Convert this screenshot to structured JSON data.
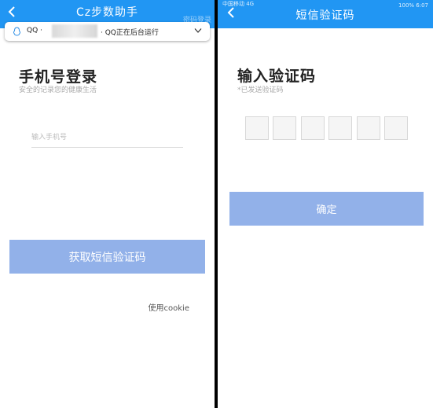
{
  "left": {
    "appbar": {
      "title": "Cz步数助手",
      "right_action": "密码登录"
    },
    "notification": {
      "app": "QQ ·",
      "message": "· QQ正在后台运行"
    },
    "title": "手机号登录",
    "subtitle": "安全的记录您的健康生活",
    "phone_placeholder": "输入手机号",
    "get_code_button": "获取短信验证码",
    "cookie_link": "使用cookie"
  },
  "right": {
    "status": {
      "left": "中国移动 4G",
      "right": "100% 6:07"
    },
    "appbar": {
      "title": "短信验证码"
    },
    "title": "输入验证码",
    "subtitle": "*已发送验证码",
    "code_boxes": [
      "",
      "",
      "",
      "",
      "",
      ""
    ],
    "confirm_button": "确定"
  },
  "colors": {
    "primary": "#2196f3",
    "button": "#92b1e9"
  },
  "icons": [
    "back-arrow-icon",
    "qq-penguin-icon",
    "chevron-down-icon"
  ]
}
